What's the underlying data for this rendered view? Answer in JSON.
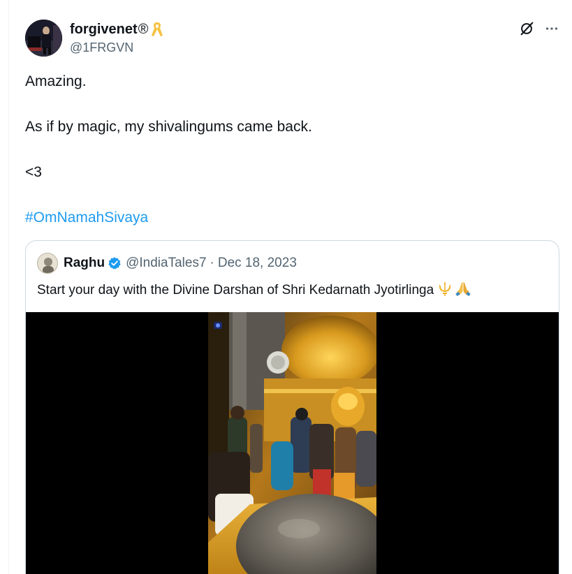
{
  "author": {
    "display_name": "forgivenet",
    "registered_mark": "®",
    "handle": "@1FRGVN",
    "badge_icon": "yellow-ribbon-icon"
  },
  "actions": {
    "grok_icon": "grok-icon",
    "more_icon": "more-icon"
  },
  "post": {
    "line1": "Amazing.",
    "line2": "As if by magic, my shivalingums came back.",
    "line3": "<3",
    "hashtag": "#OmNamahSivaya"
  },
  "quote": {
    "name": "Raghu",
    "handle": "@IndiaTales7",
    "separator": "·",
    "date": "Dec 18, 2023",
    "text": "Start your day with the Divine Darshan of Shri Kedarnath Jyotirlinga",
    "emojis": [
      "trident-emoji",
      "folded-hands-emoji"
    ]
  },
  "colors": {
    "accent": "#1d9bf0",
    "secondary_text": "#536471",
    "border": "#cfd9de",
    "verified": "#1d9bf0",
    "ribbon": "#f5c242"
  }
}
